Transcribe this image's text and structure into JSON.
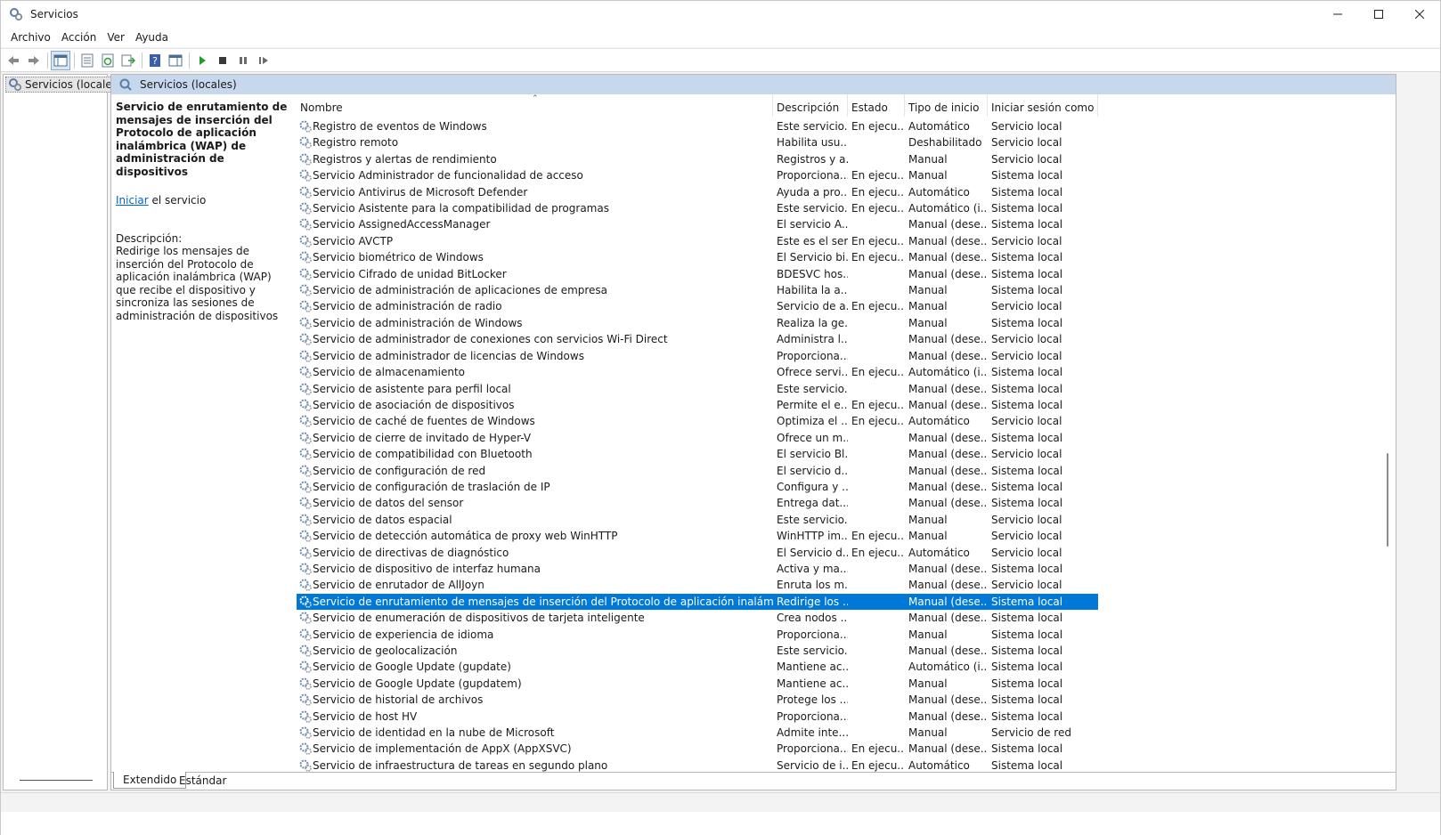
{
  "window": {
    "title": "Servicios",
    "controls": {
      "minimize": "—",
      "maximize": "☐",
      "close": "✕"
    }
  },
  "menu": [
    "Archivo",
    "Acción",
    "Ver",
    "Ayuda"
  ],
  "toolbar": {
    "icons": [
      "back-icon",
      "forward-icon",
      "show-hide-console-tree-icon",
      "properties-icon",
      "refresh-icon",
      "export-list-icon",
      "help-icon",
      "show-hide-action-pane-icon",
      "start-service-icon",
      "stop-service-icon",
      "pause-service-icon",
      "restart-service-icon"
    ]
  },
  "tree": {
    "root_label": "Servicios (locales)"
  },
  "pane": {
    "header_label": "Servicios (locales)",
    "selected_title": "Servicio de enrutamiento de mensajes de inserción del Protocolo de aplicación inalámbrica (WAP) de administración de dispositivos",
    "action_link": "Iniciar",
    "action_suffix": " el servicio",
    "description_label": "Descripción:",
    "description_text": "Redirige los mensajes de inserción del Protocolo de aplicación inalámbrica (WAP) que recibe el dispositivo y sincroniza las sesiones de administración de dispositivos"
  },
  "columns": {
    "name": "Nombre",
    "description": "Descripción",
    "status": "Estado",
    "startup": "Tipo de inicio",
    "logon": "Iniciar sesión como"
  },
  "services": [
    {
      "name": "Registro de eventos de Windows",
      "desc": "Este servicio...",
      "status": "En ejecu...",
      "startup": "Automático",
      "logon": "Servicio local"
    },
    {
      "name": "Registro remoto",
      "desc": "Habilita usu...",
      "status": "",
      "startup": "Deshabilitado",
      "logon": "Servicio local"
    },
    {
      "name": "Registros y alertas de rendimiento",
      "desc": "Registros y a...",
      "status": "",
      "startup": "Manual",
      "logon": "Servicio local"
    },
    {
      "name": "Servicio Administrador de funcionalidad de acceso",
      "desc": "Proporciona...",
      "status": "En ejecu...",
      "startup": "Manual",
      "logon": "Sistema local"
    },
    {
      "name": "Servicio Antivirus de Microsoft Defender",
      "desc": "Ayuda a pro...",
      "status": "En ejecu...",
      "startup": "Automático",
      "logon": "Sistema local"
    },
    {
      "name": "Servicio Asistente para la compatibilidad de programas",
      "desc": "Este servicio...",
      "status": "En ejecu...",
      "startup": "Automático (i...",
      "logon": "Sistema local"
    },
    {
      "name": "Servicio AssignedAccessManager",
      "desc": "El servicio A...",
      "status": "",
      "startup": "Manual (dese...",
      "logon": "Sistema local"
    },
    {
      "name": "Servicio AVCTP",
      "desc": "Este es el ser...",
      "status": "En ejecu...",
      "startup": "Manual (dese...",
      "logon": "Servicio local"
    },
    {
      "name": "Servicio biométrico de Windows",
      "desc": "El Servicio bi...",
      "status": "En ejecu...",
      "startup": "Manual (dese...",
      "logon": "Sistema local"
    },
    {
      "name": "Servicio Cifrado de unidad BitLocker",
      "desc": "BDESVC hos...",
      "status": "",
      "startup": "Manual (dese...",
      "logon": "Sistema local"
    },
    {
      "name": "Servicio de administración de aplicaciones de empresa",
      "desc": "Habilita la a...",
      "status": "",
      "startup": "Manual",
      "logon": "Sistema local"
    },
    {
      "name": "Servicio de administración de radio",
      "desc": "Servicio de a...",
      "status": "En ejecu...",
      "startup": "Manual",
      "logon": "Servicio local"
    },
    {
      "name": "Servicio de administración de Windows",
      "desc": "Realiza la ge...",
      "status": "",
      "startup": "Manual",
      "logon": "Sistema local"
    },
    {
      "name": "Servicio de administrador de conexiones con servicios Wi-Fi Direct",
      "desc": "Administra l...",
      "status": "",
      "startup": "Manual (dese...",
      "logon": "Servicio local"
    },
    {
      "name": "Servicio de administrador de licencias de Windows",
      "desc": "Proporciona...",
      "status": "",
      "startup": "Manual (dese...",
      "logon": "Servicio local"
    },
    {
      "name": "Servicio de almacenamiento",
      "desc": "Ofrece servi...",
      "status": "En ejecu...",
      "startup": "Automático (i...",
      "logon": "Sistema local"
    },
    {
      "name": "Servicio de asistente para perfil local",
      "desc": "Este servicio...",
      "status": "",
      "startup": "Manual (dese...",
      "logon": "Sistema local"
    },
    {
      "name": "Servicio de asociación de dispositivos",
      "desc": "Permite el e...",
      "status": "En ejecu...",
      "startup": "Manual (dese...",
      "logon": "Sistema local"
    },
    {
      "name": "Servicio de caché de fuentes de Windows",
      "desc": "Optimiza el ...",
      "status": "En ejecu...",
      "startup": "Automático",
      "logon": "Servicio local"
    },
    {
      "name": "Servicio de cierre de invitado de Hyper-V",
      "desc": "Ofrece un m...",
      "status": "",
      "startup": "Manual (dese...",
      "logon": "Sistema local"
    },
    {
      "name": "Servicio de compatibilidad con Bluetooth",
      "desc": "El servicio Bl...",
      "status": "",
      "startup": "Manual (dese...",
      "logon": "Servicio local"
    },
    {
      "name": "Servicio de configuración de red",
      "desc": "El servicio d...",
      "status": "",
      "startup": "Manual (dese...",
      "logon": "Sistema local"
    },
    {
      "name": "Servicio de configuración de traslación de IP",
      "desc": "Configura y ...",
      "status": "",
      "startup": "Manual (dese...",
      "logon": "Sistema local"
    },
    {
      "name": "Servicio de datos del sensor",
      "desc": "Entrega dat...",
      "status": "",
      "startup": "Manual (dese...",
      "logon": "Sistema local"
    },
    {
      "name": "Servicio de datos espacial",
      "desc": "Este servicio...",
      "status": "",
      "startup": "Manual",
      "logon": "Servicio local"
    },
    {
      "name": "Servicio de detección automática de proxy web WinHTTP",
      "desc": "WinHTTP im...",
      "status": "En ejecu...",
      "startup": "Manual",
      "logon": "Servicio local"
    },
    {
      "name": "Servicio de directivas de diagnóstico",
      "desc": "El Servicio d...",
      "status": "En ejecu...",
      "startup": "Automático",
      "logon": "Servicio local"
    },
    {
      "name": "Servicio de dispositivo de interfaz humana",
      "desc": "Activa y ma...",
      "status": "",
      "startup": "Manual (dese...",
      "logon": "Sistema local"
    },
    {
      "name": "Servicio de enrutador de AllJoyn",
      "desc": "Enruta los m...",
      "status": "",
      "startup": "Manual (dese...",
      "logon": "Servicio local"
    },
    {
      "name": "Servicio de enrutamiento de mensajes de inserción del Protocolo de aplicación inalámbrica (WAP) ...",
      "desc": "Redirige los ...",
      "status": "",
      "startup": "Manual (dese...",
      "logon": "Sistema local",
      "selected": true
    },
    {
      "name": "Servicio de enumeración de dispositivos de tarjeta inteligente",
      "desc": "Crea nodos ...",
      "status": "",
      "startup": "Manual (dese...",
      "logon": "Sistema local"
    },
    {
      "name": "Servicio de experiencia de idioma",
      "desc": "Proporciona...",
      "status": "",
      "startup": "Manual",
      "logon": "Sistema local"
    },
    {
      "name": "Servicio de geolocalización",
      "desc": "Este servicio...",
      "status": "",
      "startup": "Manual (dese...",
      "logon": "Sistema local"
    },
    {
      "name": "Servicio de Google Update (gupdate)",
      "desc": "Mantiene ac...",
      "status": "",
      "startup": "Automático (i...",
      "logon": "Sistema local"
    },
    {
      "name": "Servicio de Google Update (gupdatem)",
      "desc": "Mantiene ac...",
      "status": "",
      "startup": "Manual",
      "logon": "Sistema local"
    },
    {
      "name": "Servicio de historial de archivos",
      "desc": "Protege los ...",
      "status": "",
      "startup": "Manual (dese...",
      "logon": "Sistema local"
    },
    {
      "name": "Servicio de host HV",
      "desc": "Proporciona...",
      "status": "",
      "startup": "Manual (dese...",
      "logon": "Sistema local"
    },
    {
      "name": "Servicio de identidad en la nube de Microsoft",
      "desc": "Admite inte...",
      "status": "",
      "startup": "Manual",
      "logon": "Servicio de red"
    },
    {
      "name": "Servicio de implementación de AppX (AppXSVC)",
      "desc": "Proporciona...",
      "status": "En ejecu...",
      "startup": "Manual (dese...",
      "logon": "Sistema local"
    },
    {
      "name": "Servicio de infraestructura de tareas en segundo plano",
      "desc": "Servicio de i...",
      "status": "En ejecu...",
      "startup": "Automático",
      "logon": "Sistema local"
    }
  ],
  "tabs": [
    "Extendido",
    "Estándar"
  ],
  "colors": {
    "selection": "#0078d7",
    "pane_header": "#c7d7ec",
    "link": "#0066cc"
  }
}
